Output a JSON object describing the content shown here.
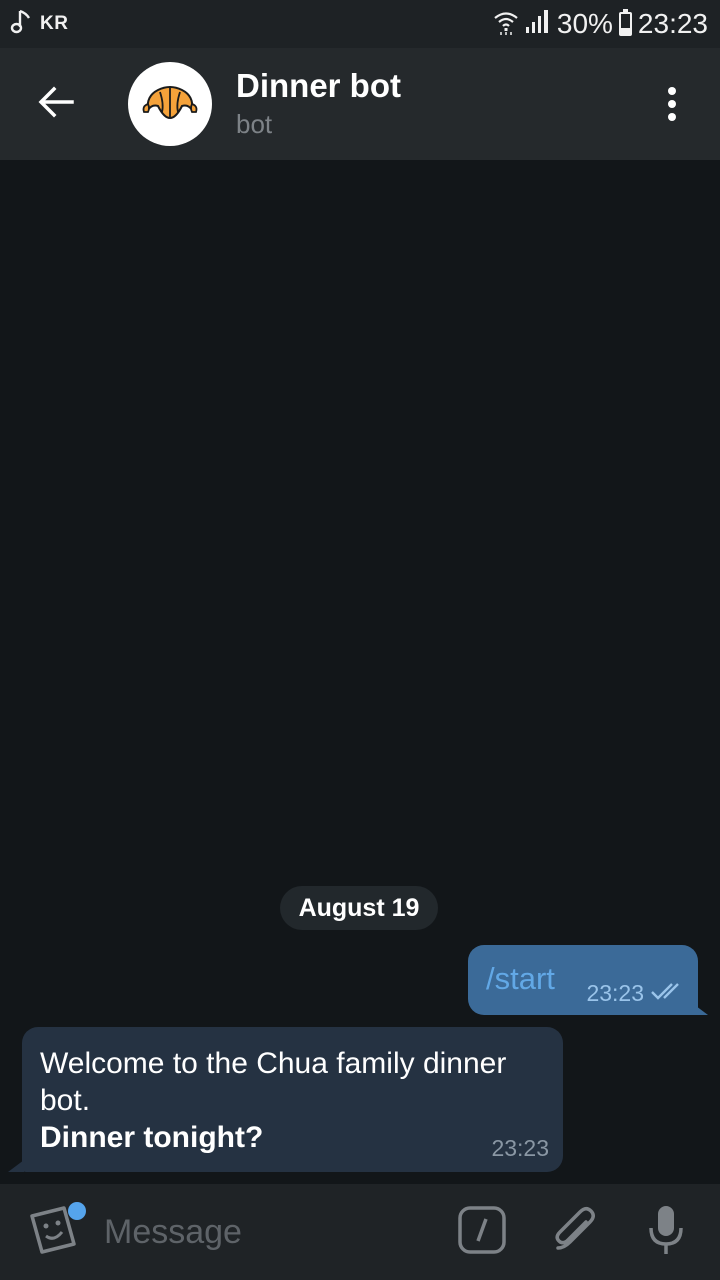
{
  "status_bar": {
    "carrier": "KR",
    "battery": "30%",
    "battery_level": 0.3,
    "time": "23:23",
    "icons": [
      "music-note-icon",
      "wifi-icon",
      "signal-icon",
      "battery-icon"
    ]
  },
  "header": {
    "title": "Dinner bot",
    "subtitle": "bot",
    "avatar_icon": "croissant-icon",
    "back_icon": "back-arrow-icon",
    "menu_icon": "more-vertical-icon"
  },
  "chat": {
    "date_label": "August 19",
    "messages": [
      {
        "direction": "outgoing",
        "text": "/start",
        "time": "23:23",
        "status_icon": "double-check-icon"
      },
      {
        "direction": "incoming",
        "line1": "Welcome to the Chua family dinner bot.",
        "line2": "Dinner tonight?",
        "time": "23:23"
      }
    ]
  },
  "input_bar": {
    "placeholder": "Message",
    "icons": [
      "sticker-icon",
      "bot-command-icon",
      "attach-icon",
      "mic-icon"
    ]
  },
  "colors": {
    "header_bg": "#25292c",
    "chat_bg": "#121619",
    "outgoing_bubble": "#3b6a98",
    "incoming_bubble": "#253242",
    "accent": "#55a4ec"
  }
}
